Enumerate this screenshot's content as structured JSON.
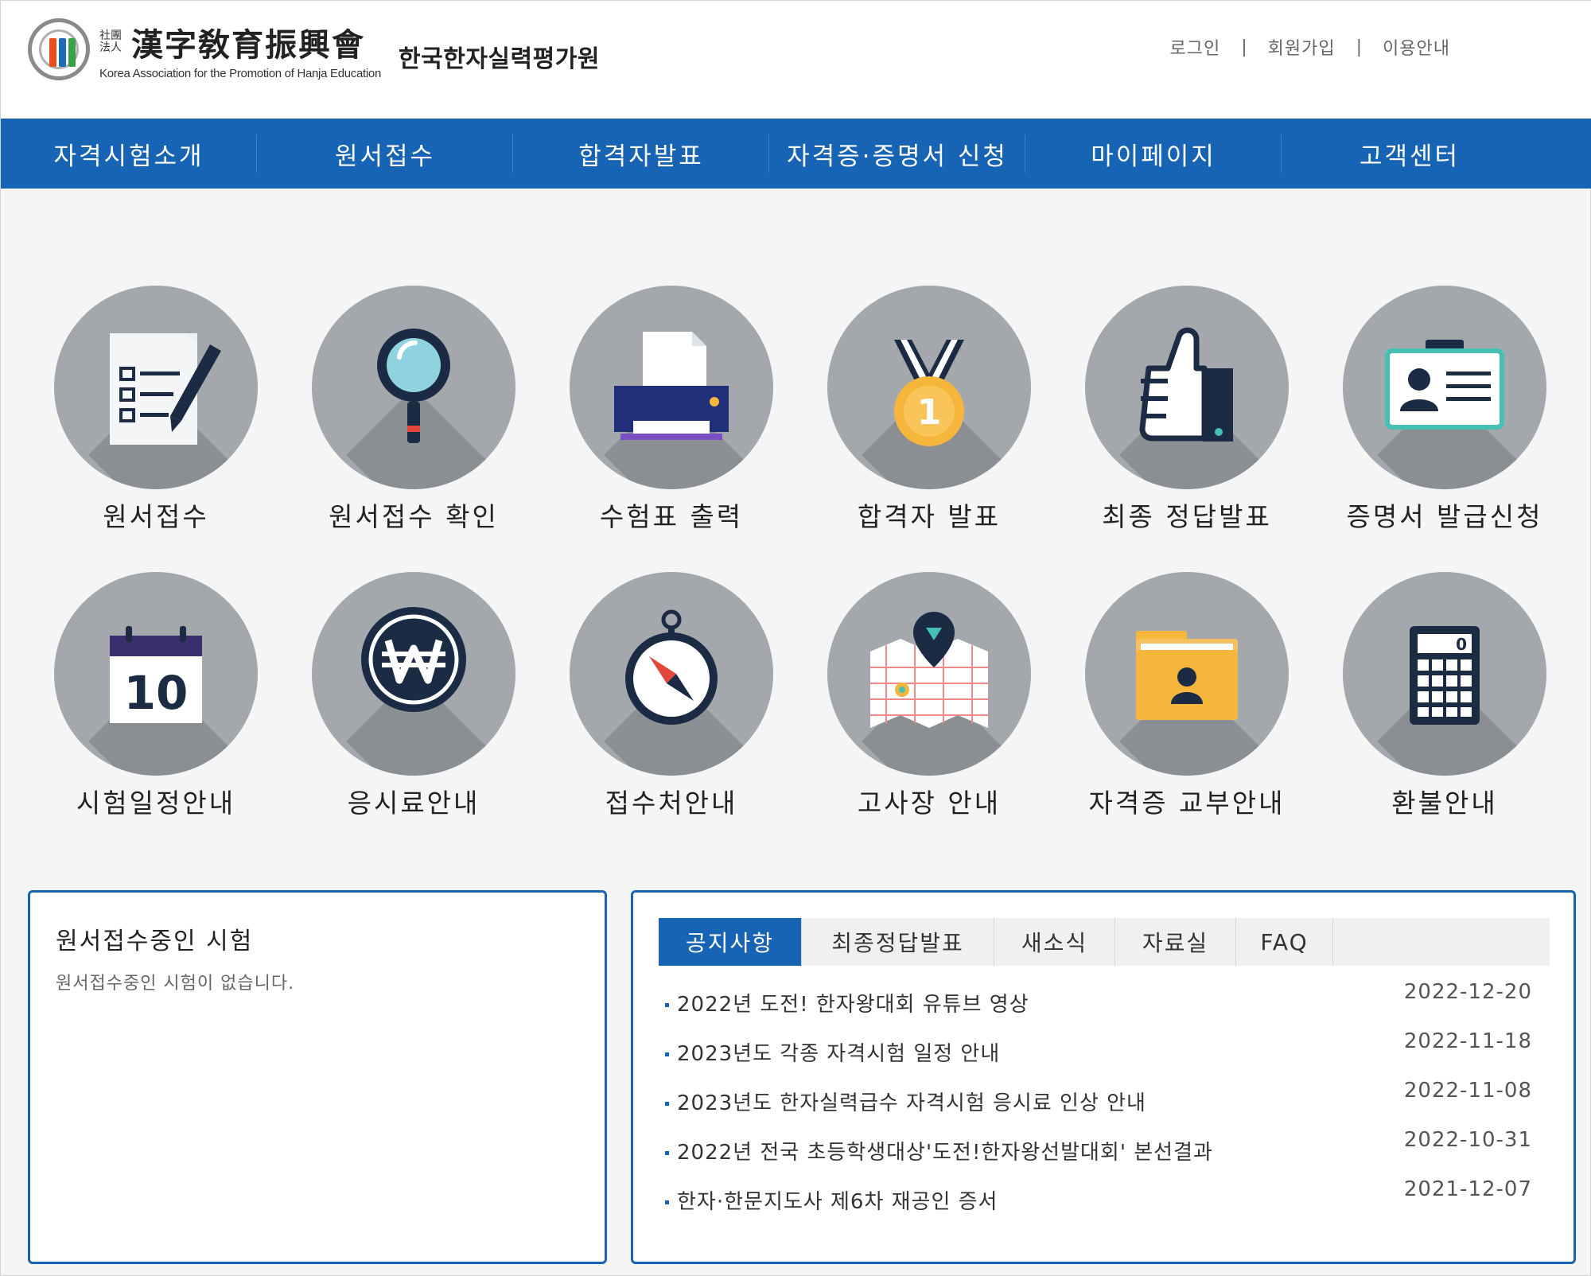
{
  "header": {
    "logo_small": "社團法人",
    "logo_hanja": "漢字敎育振興會",
    "logo_eng": "Korea Association for the Promotion of Hanja Education",
    "logo_korean": "한국한자실력평가원",
    "links": [
      "로그인",
      "회원가입",
      "이용안내"
    ]
  },
  "nav": [
    "자격시험소개",
    "원서접수",
    "합격자발표",
    "자격증·증명서 신청",
    "마이페이지",
    "고객센터"
  ],
  "quick_menu": [
    {
      "label": "원서접수",
      "icon": "application-form-icon"
    },
    {
      "label": "원서접수 확인",
      "icon": "magnifier-icon"
    },
    {
      "label": "수험표 출력",
      "icon": "printer-icon"
    },
    {
      "label": "합격자 발표",
      "icon": "medal-icon"
    },
    {
      "label": "최종 정답발표",
      "icon": "thumbs-up-icon"
    },
    {
      "label": "증명서 발급신청",
      "icon": "id-card-icon"
    },
    {
      "label": "시험일정안내",
      "icon": "calendar-icon"
    },
    {
      "label": "응시료안내",
      "icon": "won-coin-icon"
    },
    {
      "label": "접수처안내",
      "icon": "compass-icon"
    },
    {
      "label": "고사장 안내",
      "icon": "map-icon"
    },
    {
      "label": "자격증 교부안내",
      "icon": "folder-icon"
    },
    {
      "label": "환불안내",
      "icon": "calculator-icon"
    }
  ],
  "calendar_number": "10",
  "medal_number": "1",
  "calc_display": "0",
  "applying": {
    "title": "원서접수중인 시험",
    "message": "원서접수중인 시험이 없습니다."
  },
  "board": {
    "tabs": [
      "공지사항",
      "최종정답발표",
      "새소식",
      "자료실",
      "FAQ"
    ],
    "active_tab": "공지사항",
    "items": [
      {
        "title": "2022년 도전! 한자왕대회 유튜브 영상",
        "date": "2022-12-20"
      },
      {
        "title": "2023년도 각종 자격시험 일정 안내",
        "date": "2022-11-18"
      },
      {
        "title": "2023년도 한자실력급수 자격시험 응시료 인상 안내",
        "date": "2022-11-08"
      },
      {
        "title": "2022년 전국 초등학생대상'도전!한자왕선발대회' 본선결과",
        "date": "2022-10-31"
      },
      {
        "title": "한자·한문지도사 제6차 재공인 증서",
        "date": "2021-12-07"
      }
    ]
  },
  "colors": {
    "brand_blue": "#1864b4",
    "circle_gray": "#a4a8ad",
    "shadow_gray": "#8b8f94"
  }
}
